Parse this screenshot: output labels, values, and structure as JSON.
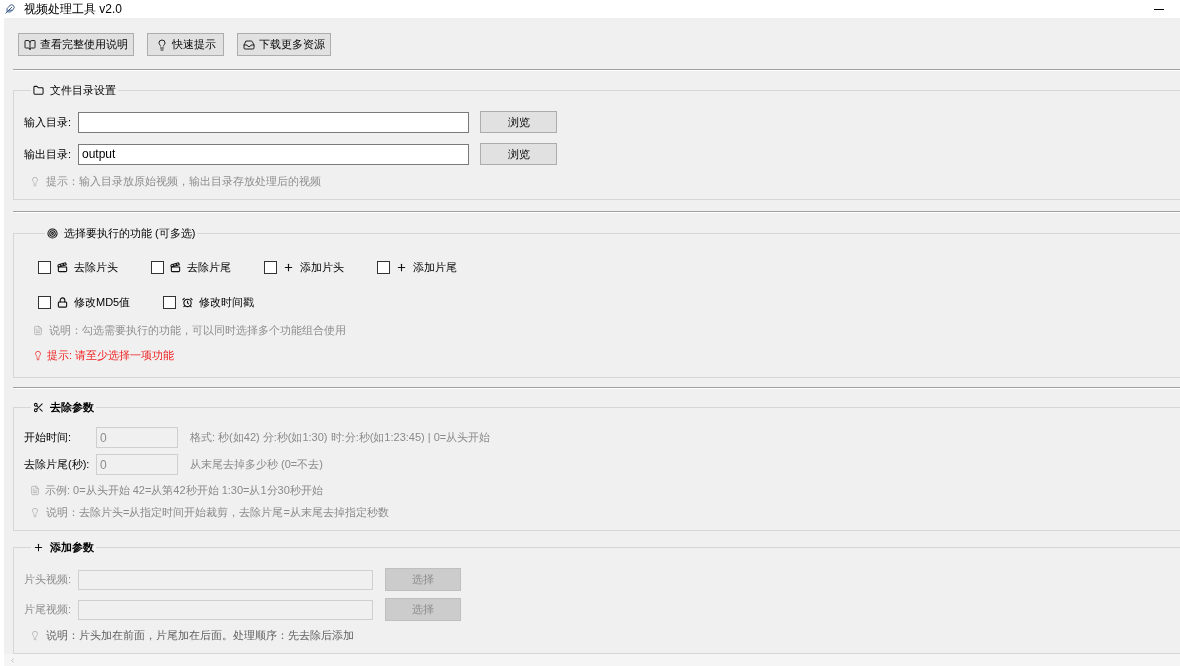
{
  "window": {
    "title": "视频处理工具 v2.0"
  },
  "toolbar": [
    {
      "label": "查看完整使用说明"
    },
    {
      "label": "快速提示"
    },
    {
      "label": "下载更多资源"
    }
  ],
  "directory_settings": {
    "title": "文件目录设置",
    "fields": [
      {
        "label": "输入目录:",
        "button": "浏览"
      },
      {
        "label": "输出目录:",
        "value": "output",
        "button": "浏览"
      }
    ],
    "hint": "提示：输入目录放原始视频，输出目录存放处理后的视频"
  },
  "functions": {
    "title": "选择要执行的功能 (可多选)",
    "rows": [
      [
        {
          "label": "去除片头",
          "checked": false
        },
        {
          "label": "去除片尾",
          "checked": false
        },
        {
          "label": "添加片头",
          "checked": false
        },
        {
          "label": "添加片尾",
          "checked": false
        }
      ],
      [
        {
          "label": "修改MD5值",
          "checked": false
        },
        {
          "label": "修改时间戳",
          "checked": false
        }
      ]
    ],
    "note": "说明：勾选需要执行的功能，可以同时选择多个功能组合使用",
    "warning": "提示: 请至少选择一项功能"
  },
  "remove_params": {
    "title": "去除参数",
    "fields": [
      {
        "label": "开始时间:",
        "value": "0",
        "disabled": true,
        "hint": "格式: 秒(如42) 分:秒(如1:30) 时:分:秒(如1:23:45) | 0=从头开始"
      },
      {
        "label": "去除片尾(秒):",
        "value": "0",
        "disabled": true,
        "hint": "从末尾去掉多少秒 (0=不去)"
      }
    ],
    "example": "示例: 0=从头开始 42=从第42秒开始 1:30=从1分30秒开始",
    "note": "说明：去除片头=从指定时间开始裁剪，去除片尾=从末尾去掉指定秒数"
  },
  "add_params": {
    "title": "添加参数",
    "fields": [
      {
        "label": "片头视频:",
        "button": "选择",
        "disabled": true
      },
      {
        "label": "片尾视频:",
        "button": "选择",
        "disabled": true
      }
    ],
    "note": "说明：片头加在前面，片尾加在后面。处理顺序：先去除后添加"
  }
}
